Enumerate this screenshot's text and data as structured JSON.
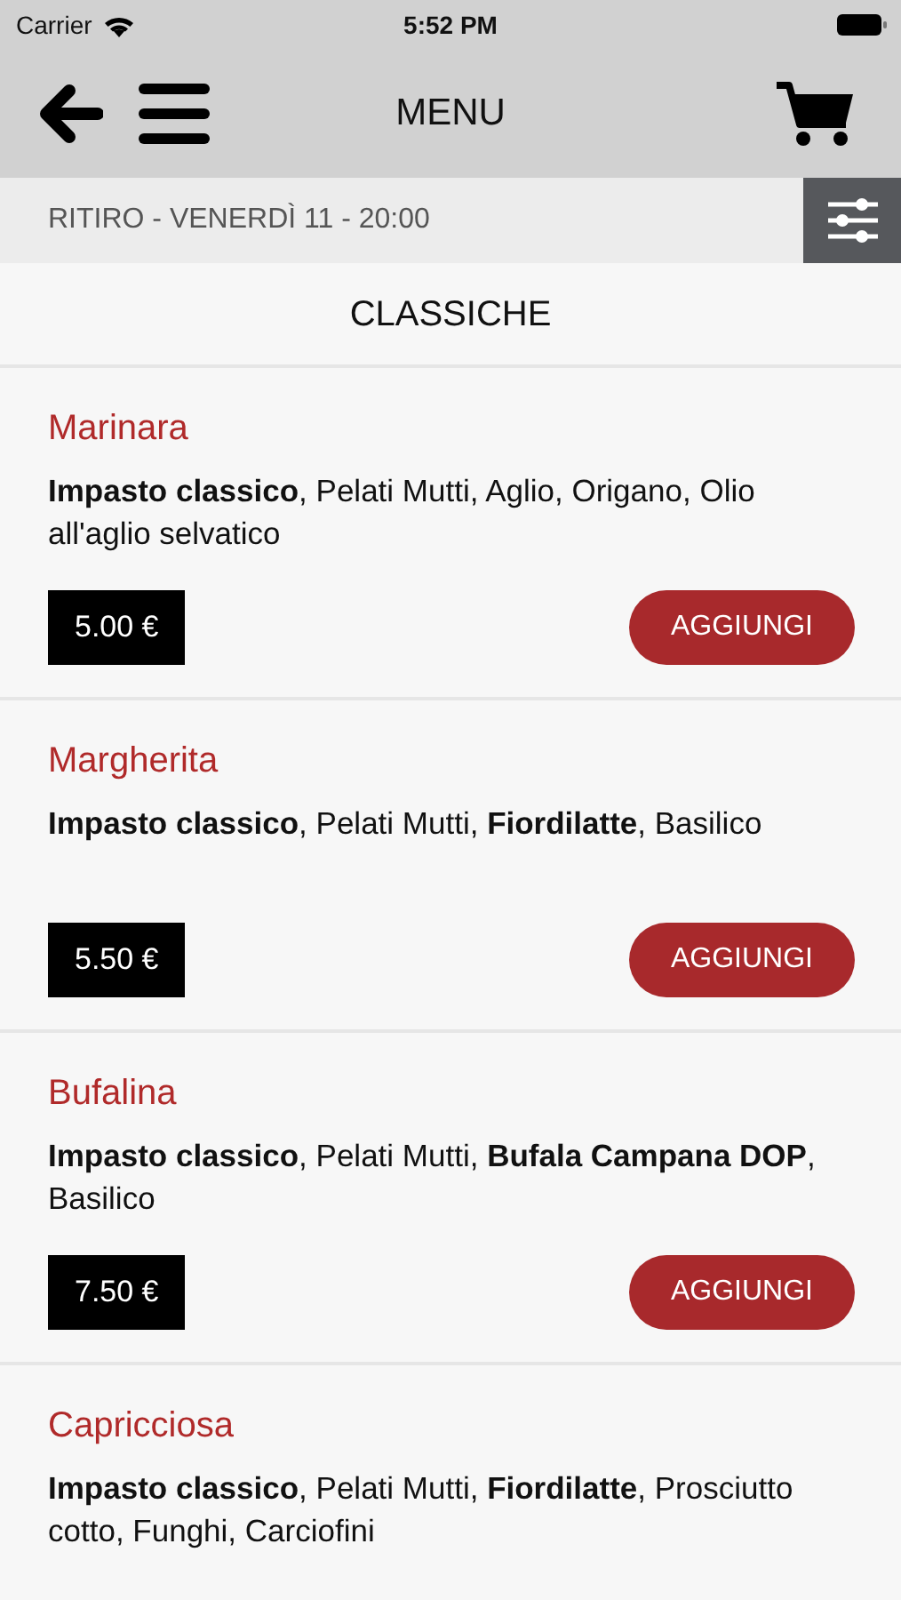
{
  "status_bar": {
    "carrier": "Carrier",
    "time": "5:52 PM"
  },
  "header": {
    "title": "MENU"
  },
  "pickup_bar": {
    "text": "RITIRO - VENERDÌ 11 - 20:00"
  },
  "category": {
    "title": "CLASSICHE"
  },
  "items": [
    {
      "name": "Marinara",
      "description": "**Impasto classico**, Pelati Mutti, Aglio, Origano, Olio all'aglio selvatico",
      "price": "5.00 €",
      "button": "AGGIUNGI"
    },
    {
      "name": "Margherita",
      "description": "**Impasto classico**, Pelati Mutti, **Fiordilatte**, Basilico",
      "price": "5.50 €",
      "button": "AGGIUNGI"
    },
    {
      "name": "Bufalina",
      "description": "**Impasto classico**, Pelati Mutti, **Bufala Campana DOP**, Basilico",
      "price": "7.50 €",
      "button": "AGGIUNGI"
    },
    {
      "name": "Capricciosa",
      "description": "**Impasto classico**, Pelati Mutti, **Fiordilatte**, Prosciutto cotto, Funghi, Carciofini"
    }
  ]
}
